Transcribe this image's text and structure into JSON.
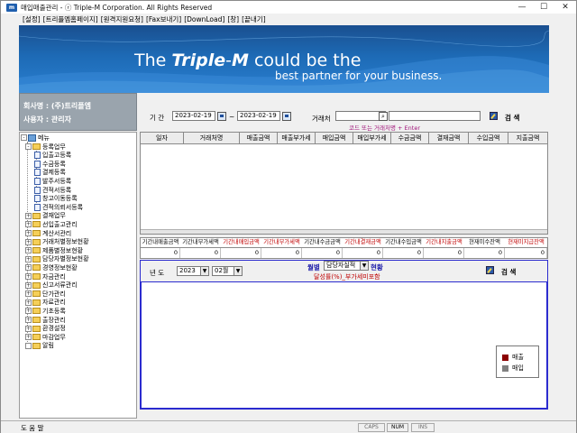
{
  "window": {
    "title": "매입매출관리 - ⓡ Triple-M Corporation. All Rights Reserved",
    "app_icon_text": "m",
    "controls": {
      "minimize": "—",
      "maximize": "☐",
      "close": "✕"
    }
  },
  "menubar": {
    "items": [
      "[설정]",
      "[트리플엠홈페이지]",
      "[원격지원요청]",
      "[Fax보내기]",
      "[DownLoad]",
      "[창]",
      "[끝내기]"
    ]
  },
  "banner": {
    "line1_pre": "The ",
    "line1_brand": "Triple",
    "line1_dash": "-",
    "line1_m": "M",
    "line1_post": " could be the",
    "line2": "best partner for your business."
  },
  "company": {
    "name_line": "회사명 : (주)트리플엠",
    "user_line": "사용자 : 관리자"
  },
  "filter": {
    "period_label": "기 간",
    "date_from": "2023-02-19",
    "tilde": "~",
    "date_to": "2023-02-19",
    "partner_label": "거래처",
    "partner_value": "",
    "hint": "코드 또는 거래처명 + Enter",
    "search_label": "검 색"
  },
  "tree": {
    "root": "메뉴",
    "items": [
      {
        "label": "등록업무",
        "type": "folder",
        "level": 1,
        "toggle": "-"
      },
      {
        "label": "입출고등록",
        "type": "doc",
        "level": 2
      },
      {
        "label": "수금등록",
        "type": "doc",
        "level": 2
      },
      {
        "label": "결제등록",
        "type": "doc",
        "level": 2
      },
      {
        "label": "발주서등록",
        "type": "doc",
        "level": 2
      },
      {
        "label": "견적서등록",
        "type": "doc",
        "level": 2
      },
      {
        "label": "창고이동등록",
        "type": "doc",
        "level": 2
      },
      {
        "label": "견적의뢰서등록",
        "type": "doc",
        "level": 2
      },
      {
        "label": "결재업무",
        "type": "folder",
        "level": 1,
        "toggle": "+"
      },
      {
        "label": "선입출고관리",
        "type": "folder",
        "level": 1,
        "toggle": "+"
      },
      {
        "label": "계산서관리",
        "type": "folder",
        "level": 1,
        "toggle": "+"
      },
      {
        "label": "거래처별정보현황",
        "type": "folder",
        "level": 1,
        "toggle": "+"
      },
      {
        "label": "제품별정보현황",
        "type": "folder",
        "level": 1,
        "toggle": "+"
      },
      {
        "label": "담당자별정보현황",
        "type": "folder",
        "level": 1,
        "toggle": "+"
      },
      {
        "label": "경영정보현황",
        "type": "folder",
        "level": 1,
        "toggle": "+"
      },
      {
        "label": "자금관리",
        "type": "folder",
        "level": 1,
        "toggle": "+"
      },
      {
        "label": "신고서류관리",
        "type": "folder",
        "level": 1,
        "toggle": "+"
      },
      {
        "label": "단가관리",
        "type": "folder",
        "level": 1,
        "toggle": "+"
      },
      {
        "label": "자료관리",
        "type": "folder",
        "level": 1,
        "toggle": "+"
      },
      {
        "label": "기초등록",
        "type": "folder",
        "level": 1,
        "toggle": "+"
      },
      {
        "label": "출장관리",
        "type": "folder",
        "level": 1,
        "toggle": "+"
      },
      {
        "label": "환경설정",
        "type": "folder",
        "level": 1,
        "toggle": "+"
      },
      {
        "label": "마감업무",
        "type": "folder",
        "level": 1,
        "toggle": "+"
      },
      {
        "label": "알림",
        "type": "folder",
        "level": 1,
        "toggle": ""
      }
    ]
  },
  "grid": {
    "columns": [
      "일자",
      "거래처명",
      "매출금액",
      "매출부가세",
      "매입금액",
      "매입부가세",
      "수금금액",
      "결재금액",
      "수입금액",
      "지출금액"
    ],
    "rows": []
  },
  "totals": {
    "headers": [
      {
        "text": "기간내매출금액",
        "color": "#000000"
      },
      {
        "text": "기간내부가세액",
        "color": "#000000"
      },
      {
        "text": "기간내매입금액",
        "color": "#c00000"
      },
      {
        "text": "기간내부가세액",
        "color": "#c00000"
      },
      {
        "text": "기간내수금금액",
        "color": "#000000"
      },
      {
        "text": "기간내결재금액",
        "color": "#c00000"
      },
      {
        "text": "기간내수입금액",
        "color": "#000000"
      },
      {
        "text": "기간내지출금액",
        "color": "#c00000"
      },
      {
        "text": "현재미수잔액",
        "color": "#000000"
      },
      {
        "text": "현재미지급잔액",
        "color": "#c00000"
      }
    ],
    "values": [
      "0",
      "0",
      "0",
      "0",
      "0",
      "0",
      "0",
      "0",
      "0",
      "0"
    ]
  },
  "chart_panel": {
    "year_label": "년 도",
    "year_value": "2023",
    "month_value": "02월",
    "monthly_label": "월별",
    "type_value": "담당자실적",
    "status_label": "현황",
    "subtitle": "달성률(%)_부가세미포함",
    "search_label": "검 색",
    "legend": [
      {
        "name": "매출",
        "color": "#8b0000"
      },
      {
        "name": "매입",
        "color": "#808080"
      }
    ]
  },
  "statusbar": {
    "help": "도 움 말",
    "caps": "CAPS",
    "num": "NUM",
    "ins": "INS"
  },
  "colors": {
    "banner_blue": "#1d6ab5",
    "hint_magenta": "#a0157a",
    "frame_blue": "#2b2bcf"
  }
}
